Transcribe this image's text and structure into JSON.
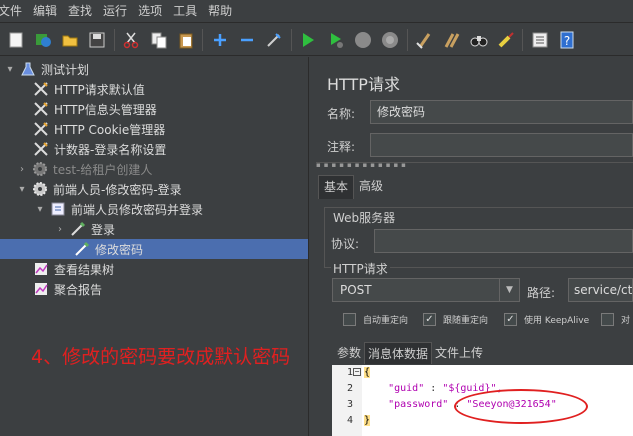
{
  "menu": [
    "文件",
    "编辑",
    "查找",
    "运行",
    "选项",
    "工具",
    "帮助"
  ],
  "toolbar_icons": [
    "new-icon",
    "templates-icon",
    "open-icon",
    "save-icon",
    "cut-icon",
    "copy-icon",
    "paste-icon",
    "expand-icon",
    "collapse-icon",
    "toggle-icon",
    "start-icon",
    "start-no-pause-icon",
    "stop-icon",
    "shutdown-icon",
    "clear-icon",
    "clear-all-icon",
    "search-icon",
    "reset-search-icon",
    "function-helper-icon",
    "help-icon"
  ],
  "tree": {
    "items": [
      {
        "label": "测试计划",
        "icon": "flask-icon"
      },
      {
        "label": "HTTP请求默认值",
        "icon": "wrench-icon"
      },
      {
        "label": "HTTP信息头管理器",
        "icon": "wrench-icon"
      },
      {
        "label": "HTTP Cookie管理器",
        "icon": "wrench-icon"
      },
      {
        "label": "计数器-登录名称设置",
        "icon": "wrench-icon"
      },
      {
        "label": "test-给租户创建人",
        "icon": "gear-icon"
      },
      {
        "label": "前端人员-修改密码-登录",
        "icon": "gear-icon"
      },
      {
        "label": "前端人员修改密码并登录",
        "icon": "controller-icon"
      },
      {
        "label": "登录",
        "icon": "pipette-icon"
      },
      {
        "label": "修改密码",
        "icon": "pipette-icon"
      },
      {
        "label": "查看结果树",
        "icon": "chart-icon"
      },
      {
        "label": "聚合报告",
        "icon": "chart-icon"
      }
    ]
  },
  "annotation": "4、修改的密码要改成默认密码",
  "panel": {
    "title": "HTTP请求",
    "name_label": "名称:",
    "name_value": "修改密码",
    "comment_label": "注释:",
    "tabs": [
      "基本",
      "高级"
    ],
    "web_server_legend": "Web服务器",
    "protocol_label": "协议:",
    "http_request_legend": "HTTP请求",
    "method": "POST",
    "path_label": "路径:",
    "path_value": "service/ctp",
    "checkboxes": [
      {
        "label": "自动重定向",
        "checked": false
      },
      {
        "label": "跟随重定向",
        "checked": true
      },
      {
        "label": "使用 KeepAlive",
        "checked": true
      },
      {
        "label": "对",
        "checked": false
      }
    ],
    "sub_tabs": [
      "参数",
      "消息体数据",
      "文件上传"
    ]
  },
  "editor": {
    "line_numbers": [
      "1",
      "2",
      "3",
      "4"
    ],
    "open_brace": "{",
    "guid_key": "\"guid\"",
    "guid_sep": ":",
    "guid_value": "\"${guid}\",",
    "password_key": "\"password\"",
    "password_sep": ":",
    "password_value": "\"Seeyon@321654\"",
    "close_brace": "}"
  },
  "colors": {
    "selection": "#4b6eaf",
    "annotation": "#e02020",
    "background": "#3c3f41"
  }
}
